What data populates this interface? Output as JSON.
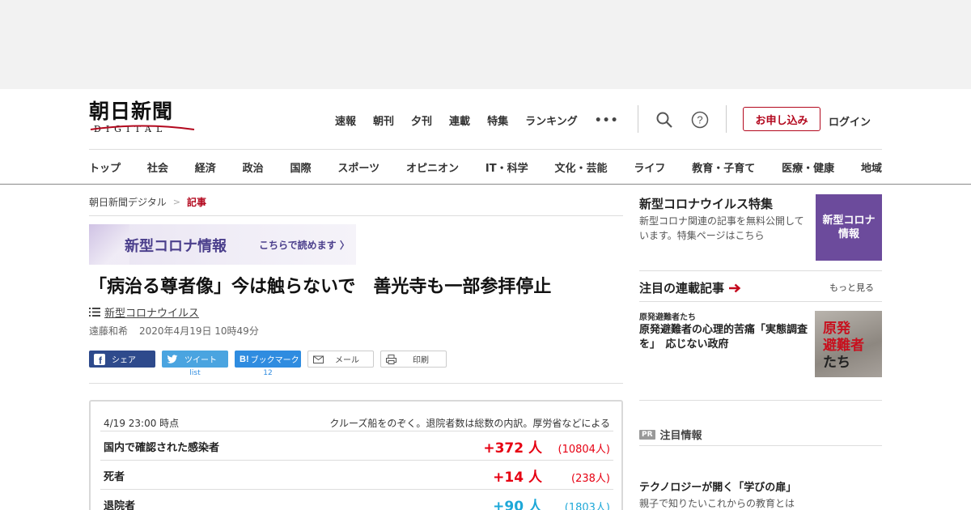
{
  "header": {
    "logo_main": "朝日新聞",
    "logo_sub": "DIGITAL",
    "top_nav": [
      "速報",
      "朝刊",
      "夕刊",
      "連載",
      "特集",
      "ランキング"
    ],
    "more_label": "•••",
    "apply_label": "お申し込み",
    "login_label": "ログイン"
  },
  "categories": [
    "トップ",
    "社会",
    "経済",
    "政治",
    "国際",
    "スポーツ",
    "オピニオン",
    "IT・科学",
    "文化・芸能",
    "ライフ",
    "教育・子育て",
    "医療・健康",
    "地域"
  ],
  "breadcrumb": {
    "home": "朝日新聞デジタル",
    "sep": ">",
    "current": "記事"
  },
  "banner": {
    "title": "新型コロナ情報",
    "link": "こちらで読めます"
  },
  "article": {
    "headline": "「病治る尊者像」今は触らないで　善光寺も一部参拝停止",
    "tag": "新型コロナウイルス",
    "author": "遠藤和希",
    "date": "2020年4月19日 10時49分"
  },
  "share": {
    "facebook": "シェア",
    "twitter": "ツイート",
    "twitter_count": "list",
    "hatena": "ブックマーク",
    "hatena_count": "12",
    "mail": "メール",
    "print": "印刷"
  },
  "stats": {
    "timestamp": "4/19 23:00 時点",
    "note": "クルーズ船をのぞく。退院者数は総数の内訳。厚労省などによる",
    "rows": [
      {
        "label": "国内で確認された感染者",
        "delta": "+372 人",
        "total": "(10804人)"
      },
      {
        "label": "死者",
        "delta": "+14 人",
        "total": "(238人)"
      },
      {
        "label": "退院者",
        "delta": "+90 人",
        "total": "(1803人)"
      }
    ]
  },
  "sidebar": {
    "feature_title": "新型コロナウイルス特集",
    "feature_desc": "新型コロナ関連の記事を無料公開しています。特集ページはこちら",
    "feature_img_line1": "新型コロナ",
    "feature_img_line2": "情報",
    "serial_title": "注目の連載記事",
    "more_label": "もっと見る",
    "serial_kicker": "原発避難者たち",
    "serial_headline": "原発避難者の心理的苦痛「実態調査を」　応じない政府",
    "serial_img_line1": "原発",
    "serial_img_line2": "避難者",
    "serial_img_line3": "たち",
    "pr_badge": "PR",
    "pr_label": "注目情報",
    "promo_title": "テクノロジーが開く「学びの扉」",
    "promo_sub": "親子で知りたいこれからの教育とは"
  },
  "colors": {
    "brand_red": "#b3081e",
    "delta_red": "#e60012",
    "delta_blue": "#1ea8d8",
    "corona_purple": "#6c4b9c"
  }
}
